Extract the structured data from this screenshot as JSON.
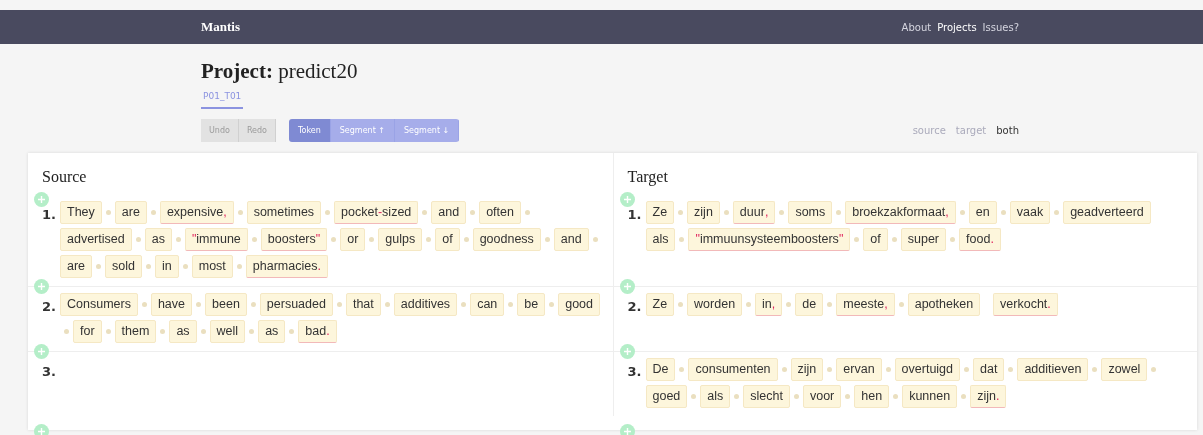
{
  "navbar": {
    "brand": "Mantis",
    "links": [
      {
        "label": "About",
        "selected": false
      },
      {
        "label": "Projects",
        "selected": true
      },
      {
        "label": "Issues?",
        "selected": false
      }
    ]
  },
  "project": {
    "label": "Project:",
    "name": "predict20"
  },
  "tabs": [
    {
      "label": "P01_T01",
      "selected": true
    }
  ],
  "toolbar": {
    "history": [
      {
        "label": "Undo",
        "disabled": true
      },
      {
        "label": "Redo",
        "disabled": true
      }
    ],
    "modes": [
      {
        "label": "Token",
        "selected": true
      },
      {
        "label": "Segment ↑",
        "selected": false
      },
      {
        "label": "Segment ↓",
        "selected": false
      }
    ]
  },
  "view": [
    {
      "label": "source",
      "selected": false
    },
    {
      "label": "target",
      "selected": false
    },
    {
      "label": "both",
      "selected": true
    }
  ],
  "panels": [
    {
      "title": "Source",
      "segments": [
        {
          "number": "1.",
          "tokens": [
            {
              "text": "They"
            },
            {
              "text": "are"
            },
            {
              "text": "expensive",
              "post": ","
            },
            {
              "text": "sometimes"
            },
            {
              "text": "pocket",
              "mid": "-",
              "rest": "sized"
            },
            {
              "text": "and"
            },
            {
              "text": "often"
            },
            {
              "text": "advertised"
            },
            {
              "text": "as"
            },
            {
              "pre": "\"",
              "text": "immune"
            },
            {
              "text": "boosters",
              "post": "\""
            },
            {
              "text": "or"
            },
            {
              "text": "gulps"
            },
            {
              "text": "of"
            },
            {
              "text": "goodness"
            },
            {
              "text": "and"
            },
            {
              "text": "are"
            },
            {
              "text": "sold"
            },
            {
              "text": "in"
            },
            {
              "text": "most"
            },
            {
              "text": "pharmacies",
              "post": "."
            }
          ]
        },
        {
          "number": "2.",
          "tokens": [
            {
              "text": "Consumers"
            },
            {
              "text": "have"
            },
            {
              "text": "been"
            },
            {
              "text": "persuaded"
            },
            {
              "text": "that"
            },
            {
              "text": "additives"
            },
            {
              "text": "can"
            },
            {
              "text": "be"
            },
            {
              "text": "good"
            },
            {
              "text": "for"
            },
            {
              "text": "them"
            },
            {
              "text": "as"
            },
            {
              "text": "well"
            },
            {
              "text": "as"
            },
            {
              "text": "bad",
              "post": "."
            }
          ]
        },
        {
          "number": "3."
        }
      ]
    },
    {
      "title": "Target",
      "segments": [
        {
          "number": "1.",
          "tokens": [
            {
              "text": "Ze"
            },
            {
              "text": "zijn"
            },
            {
              "text": "duur",
              "post": ","
            },
            {
              "text": "soms"
            },
            {
              "text": "broekzakformaat",
              "post": ","
            },
            {
              "text": "en"
            },
            {
              "text": "vaak"
            },
            {
              "text": "geadverteerd"
            },
            {
              "text": "als",
              "joined": true
            },
            {
              "pre": "\"",
              "text": "immuunsysteemboosters",
              "post": "\""
            },
            {
              "text": "of"
            },
            {
              "text": "super"
            },
            {
              "text": "food",
              "post": "."
            }
          ]
        },
        {
          "number": "2.",
          "tokens": [
            {
              "text": "Ze"
            },
            {
              "text": "worden"
            },
            {
              "text": "in",
              "post": ","
            },
            {
              "text": "de"
            },
            {
              "text": "meeste",
              "post": ","
            },
            {
              "text": "apotheken"
            },
            {
              "text": "verkocht",
              "post": ".",
              "joined": true
            }
          ]
        },
        {
          "number": "3.",
          "tokens": [
            {
              "text": "De"
            },
            {
              "text": "consumenten"
            },
            {
              "text": "zijn"
            },
            {
              "text": "ervan"
            },
            {
              "text": "overtuigd"
            },
            {
              "text": "dat"
            },
            {
              "text": "additieven"
            },
            {
              "text": "zowel"
            },
            {
              "text": "goed"
            },
            {
              "text": "als"
            },
            {
              "text": "slecht"
            },
            {
              "text": "voor"
            },
            {
              "text": "hen"
            },
            {
              "text": "kunnen"
            },
            {
              "text": "zijn",
              "post": "."
            }
          ]
        }
      ]
    }
  ]
}
